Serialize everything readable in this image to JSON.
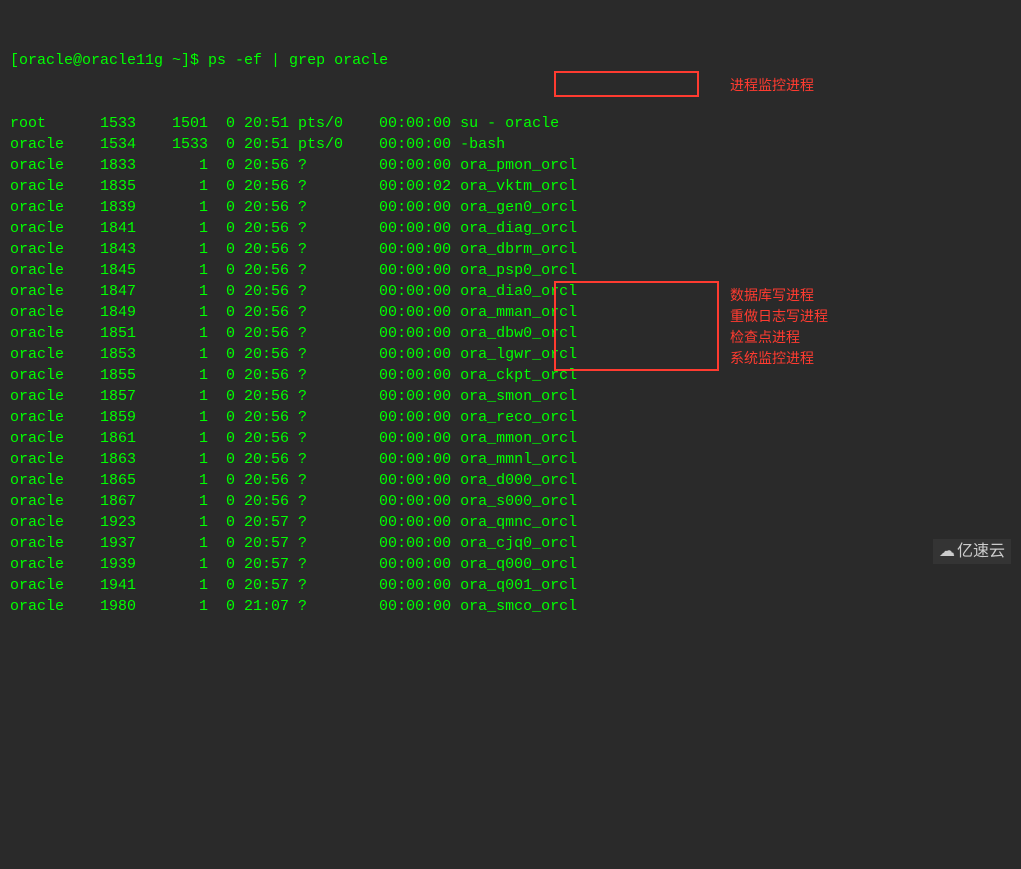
{
  "prompt": "[oracle@oracle11g ~]$ ",
  "command": "ps -ef | grep oracle",
  "rows": [
    {
      "uid": "root  ",
      "pid": "  1533",
      "ppid": "  1501",
      "c": "0",
      "stime": "20:51",
      "tty": "pts/0  ",
      "time": "00:00:00",
      "cmd": "su - oracle"
    },
    {
      "uid": "oracle",
      "pid": "  1534",
      "ppid": "  1533",
      "c": "0",
      "stime": "20:51",
      "tty": "pts/0  ",
      "time": "00:00:00",
      "cmd": "-bash"
    },
    {
      "uid": "oracle",
      "pid": "  1833",
      "ppid": "     1",
      "c": "0",
      "stime": "20:56",
      "tty": "?      ",
      "time": "00:00:00",
      "cmd": "ora_pmon_orcl"
    },
    {
      "uid": "oracle",
      "pid": "  1835",
      "ppid": "     1",
      "c": "0",
      "stime": "20:56",
      "tty": "?      ",
      "time": "00:00:02",
      "cmd": "ora_vktm_orcl"
    },
    {
      "uid": "oracle",
      "pid": "  1839",
      "ppid": "     1",
      "c": "0",
      "stime": "20:56",
      "tty": "?      ",
      "time": "00:00:00",
      "cmd": "ora_gen0_orcl"
    },
    {
      "uid": "oracle",
      "pid": "  1841",
      "ppid": "     1",
      "c": "0",
      "stime": "20:56",
      "tty": "?      ",
      "time": "00:00:00",
      "cmd": "ora_diag_orcl"
    },
    {
      "uid": "oracle",
      "pid": "  1843",
      "ppid": "     1",
      "c": "0",
      "stime": "20:56",
      "tty": "?      ",
      "time": "00:00:00",
      "cmd": "ora_dbrm_orcl"
    },
    {
      "uid": "oracle",
      "pid": "  1845",
      "ppid": "     1",
      "c": "0",
      "stime": "20:56",
      "tty": "?      ",
      "time": "00:00:00",
      "cmd": "ora_psp0_orcl"
    },
    {
      "uid": "oracle",
      "pid": "  1847",
      "ppid": "     1",
      "c": "0",
      "stime": "20:56",
      "tty": "?      ",
      "time": "00:00:00",
      "cmd": "ora_dia0_orcl"
    },
    {
      "uid": "oracle",
      "pid": "  1849",
      "ppid": "     1",
      "c": "0",
      "stime": "20:56",
      "tty": "?      ",
      "time": "00:00:00",
      "cmd": "ora_mman_orcl"
    },
    {
      "uid": "oracle",
      "pid": "  1851",
      "ppid": "     1",
      "c": "0",
      "stime": "20:56",
      "tty": "?      ",
      "time": "00:00:00",
      "cmd": "ora_dbw0_orcl"
    },
    {
      "uid": "oracle",
      "pid": "  1853",
      "ppid": "     1",
      "c": "0",
      "stime": "20:56",
      "tty": "?      ",
      "time": "00:00:00",
      "cmd": "ora_lgwr_orcl"
    },
    {
      "uid": "oracle",
      "pid": "  1855",
      "ppid": "     1",
      "c": "0",
      "stime": "20:56",
      "tty": "?      ",
      "time": "00:00:00",
      "cmd": "ora_ckpt_orcl"
    },
    {
      "uid": "oracle",
      "pid": "  1857",
      "ppid": "     1",
      "c": "0",
      "stime": "20:56",
      "tty": "?      ",
      "time": "00:00:00",
      "cmd": "ora_smon_orcl"
    },
    {
      "uid": "oracle",
      "pid": "  1859",
      "ppid": "     1",
      "c": "0",
      "stime": "20:56",
      "tty": "?      ",
      "time": "00:00:00",
      "cmd": "ora_reco_orcl"
    },
    {
      "uid": "oracle",
      "pid": "  1861",
      "ppid": "     1",
      "c": "0",
      "stime": "20:56",
      "tty": "?      ",
      "time": "00:00:00",
      "cmd": "ora_mmon_orcl"
    },
    {
      "uid": "oracle",
      "pid": "  1863",
      "ppid": "     1",
      "c": "0",
      "stime": "20:56",
      "tty": "?      ",
      "time": "00:00:00",
      "cmd": "ora_mmnl_orcl"
    },
    {
      "uid": "oracle",
      "pid": "  1865",
      "ppid": "     1",
      "c": "0",
      "stime": "20:56",
      "tty": "?      ",
      "time": "00:00:00",
      "cmd": "ora_d000_orcl"
    },
    {
      "uid": "oracle",
      "pid": "  1867",
      "ppid": "     1",
      "c": "0",
      "stime": "20:56",
      "tty": "?      ",
      "time": "00:00:00",
      "cmd": "ora_s000_orcl"
    },
    {
      "uid": "oracle",
      "pid": "  1923",
      "ppid": "     1",
      "c": "0",
      "stime": "20:57",
      "tty": "?      ",
      "time": "00:00:00",
      "cmd": "ora_qmnc_orcl"
    },
    {
      "uid": "oracle",
      "pid": "  1937",
      "ppid": "     1",
      "c": "0",
      "stime": "20:57",
      "tty": "?      ",
      "time": "00:00:00",
      "cmd": "ora_cjq0_orcl"
    },
    {
      "uid": "oracle",
      "pid": "  1939",
      "ppid": "     1",
      "c": "0",
      "stime": "20:57",
      "tty": "?      ",
      "time": "00:00:00",
      "cmd": "ora_q000_orcl"
    },
    {
      "uid": "oracle",
      "pid": "  1941",
      "ppid": "     1",
      "c": "0",
      "stime": "20:57",
      "tty": "?      ",
      "time": "00:00:00",
      "cmd": "ora_q001_orcl"
    },
    {
      "uid": "oracle",
      "pid": "  1980",
      "ppid": "     1",
      "c": "0",
      "stime": "21:07",
      "tty": "?      ",
      "time": "00:00:00",
      "cmd": "ora_smco_orcl"
    }
  ],
  "annotations": {
    "pmon": "进程监控进程",
    "dbw0": "数据库写进程",
    "lgwr": "重做日志写进程",
    "ckpt": "检查点进程",
    "smon": "系统监控进程"
  },
  "watermark": "亿速云"
}
